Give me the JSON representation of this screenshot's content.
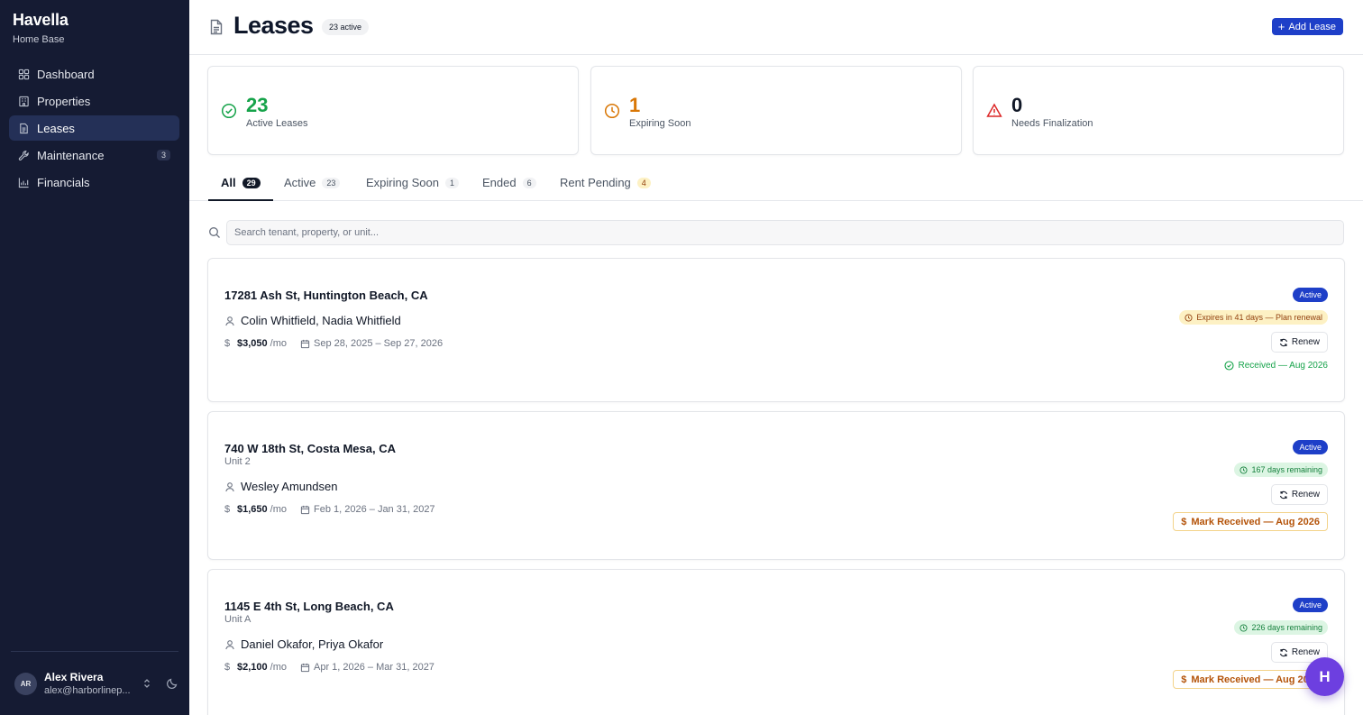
{
  "app": {
    "name": "Havella",
    "subtitle": "Home Base"
  },
  "sidebar": {
    "items": [
      {
        "label": "Dashboard",
        "icon": "grid-icon"
      },
      {
        "label": "Properties",
        "icon": "building-icon"
      },
      {
        "label": "Leases",
        "icon": "document-icon",
        "active": true
      },
      {
        "label": "Maintenance",
        "icon": "wrench-icon",
        "badge": "3"
      },
      {
        "label": "Financials",
        "icon": "chart-icon"
      }
    ],
    "user": {
      "initials": "AR",
      "name": "Alex Rivera",
      "email": "alex@harborlinep..."
    }
  },
  "header": {
    "title": "Leases",
    "count_badge": "23 active",
    "add_label": "Add Lease"
  },
  "stats": [
    {
      "value": "23",
      "label": "Active Leases",
      "color": "#16a34a",
      "icon": "check-circle-icon"
    },
    {
      "value": "1",
      "label": "Expiring Soon",
      "color": "#d97706",
      "icon": "clock-icon"
    },
    {
      "value": "0",
      "label": "Needs Finalization",
      "color": "#dc2626",
      "icon": "alert-triangle-icon"
    }
  ],
  "tabs": [
    {
      "label": "All",
      "count": "29"
    },
    {
      "label": "Active",
      "count": "23"
    },
    {
      "label": "Expiring Soon",
      "count": "1"
    },
    {
      "label": "Ended",
      "count": "6"
    },
    {
      "label": "Rent Pending",
      "count": "4"
    }
  ],
  "search": {
    "placeholder": "Search tenant, property, or unit..."
  },
  "leases": [
    {
      "address": "17281 Ash St, Huntington Beach, CA",
      "unit": "",
      "tenants": "Colin Whitfield, Nadia Whitfield",
      "rent": "$3,050",
      "per": "/mo",
      "dates": "Sep 28, 2025 – Sep 27, 2026",
      "status": "Active",
      "term_note": "Expires in 41 days — Plan renewal",
      "renew_label": "Renew",
      "payment_note": "Received — Aug 2026"
    },
    {
      "address": "740 W 18th St, Costa Mesa, CA",
      "unit": "Unit 2",
      "tenants": "Wesley Amundsen",
      "rent": "$1,650",
      "per": "/mo",
      "dates": "Feb 1, 2026 – Jan 31, 2027",
      "status": "Active",
      "term_note": "167 days remaining",
      "renew_label": "Renew",
      "payment_action": "Mark Received — Aug 2026"
    },
    {
      "address": "1145 E 4th St, Long Beach, CA",
      "unit": "Unit A",
      "tenants": "Daniel Okafor, Priya Okafor",
      "rent": "$2,100",
      "per": "/mo",
      "dates": "Apr 1, 2026 – Mar 31, 2027",
      "status": "Active",
      "term_note": "226 days remaining",
      "renew_label": "Renew",
      "payment_action": "Mark Received — Aug 2026"
    }
  ],
  "fab": {
    "label": "H"
  }
}
